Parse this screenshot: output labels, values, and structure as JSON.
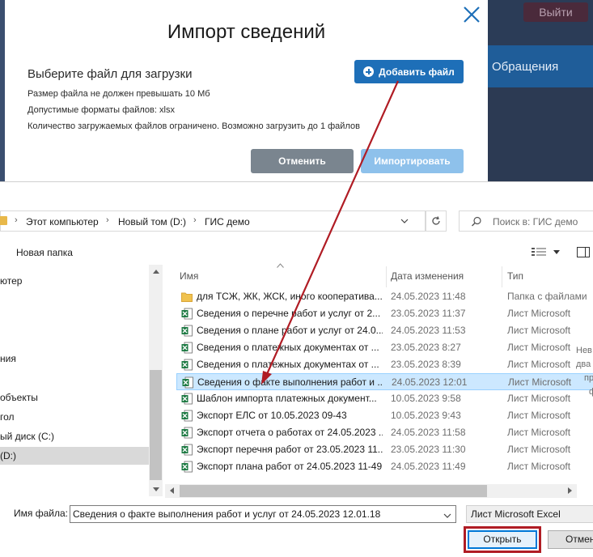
{
  "background": {
    "logout_label": "Выйти",
    "nav_item": "Обращения"
  },
  "modal": {
    "title": "Импорт сведений",
    "heading": "Выберите файл для загрузки",
    "lines": [
      "Размер файла не должен превышать 10 Мб",
      "Допустимые форматы файлов: xlsx",
      "Количество загружаемых файлов ограничено. Возможно загрузить до 1 файлов"
    ],
    "add_file_label": "Добавить файл",
    "cancel_label": "Отменить",
    "import_label": "Импортировать",
    "colors": {
      "primary": "#1e6fb8",
      "disabled": "#8ec1eb",
      "neutral": "#7a858f"
    }
  },
  "dialog": {
    "breadcrumb": [
      "Этот компьютер",
      "Новый том (D:)",
      "ГИС демо"
    ],
    "search_placeholder": "Поиск в: ГИС демо",
    "new_folder_label": "Новая папка",
    "nav_items": [
      "ютер",
      "",
      "",
      "ния",
      "",
      "объекты",
      "гол",
      "ый диск (C:)",
      "(D:)"
    ],
    "selected_nav_index": 8,
    "columns": {
      "name": "Имя",
      "date": "Дата изменения",
      "type": "Тип"
    },
    "files": [
      {
        "name": "для ТСЖ, ЖК, ЖСК, иного кооператива...",
        "date": "24.05.2023 11:48",
        "type": "Папка с файлами",
        "icon": "folder-icon"
      },
      {
        "name": "Сведения о перечне работ и услуг от 2...",
        "date": "23.05.2023 11:37",
        "type": "Лист Microsoft",
        "icon": "excel-icon"
      },
      {
        "name": "Сведения о плане работ и услуг от 24.0...",
        "date": "24.05.2023 11:53",
        "type": "Лист Microsoft",
        "icon": "excel-icon"
      },
      {
        "name": "Сведения о платежных документах от ...",
        "date": "23.05.2023 8:27",
        "type": "Лист Microsoft",
        "icon": "excel-icon"
      },
      {
        "name": "Сведения о платежных документах от ...",
        "date": "23.05.2023 8:39",
        "type": "Лист Microsoft",
        "icon": "excel-icon"
      },
      {
        "name": "Сведения о факте выполнения работ и ...",
        "date": "24.05.2023 12:01",
        "type": "Лист Microsoft",
        "icon": "excel-icon"
      },
      {
        "name": "Шаблон импорта платежных документ...",
        "date": "10.05.2023 9:58",
        "type": "Лист Microsoft",
        "icon": "excel-icon"
      },
      {
        "name": "Экспорт ЕЛС от 10.05.2023 09-43",
        "date": "10.05.2023 9:43",
        "type": "Лист Microsoft",
        "icon": "excel-icon"
      },
      {
        "name": "Экспорт отчета о работах от 24.05.2023 ...",
        "date": "24.05.2023 11:58",
        "type": "Лист Microsoft",
        "icon": "excel-icon"
      },
      {
        "name": "Экспорт перечня работ от 23.05.2023 11...",
        "date": "23.05.2023 11:30",
        "type": "Лист Microsoft",
        "icon": "excel-icon"
      },
      {
        "name": "Экспорт плана работ от 24.05.2023 11-49",
        "date": "24.05.2023 11:49",
        "type": "Лист Microsoft",
        "icon": "excel-icon"
      }
    ],
    "selected_file_index": 5,
    "preview_lines": [
      "Нев",
      "",
      "два",
      "пр",
      "",
      "ф"
    ],
    "filename_label": "Имя файла:",
    "filename_value": "Сведения о факте выполнения работ и услуг от 24.05.2023 12.01.18",
    "filetype_value": "Лист Microsoft Excel",
    "open_label": "Открыть",
    "cancel_label": "Отмен",
    "colors": {
      "selection": "#cce8ff",
      "highlight_border": "#b01c24",
      "annotation_arrow": "#b01c24"
    }
  }
}
